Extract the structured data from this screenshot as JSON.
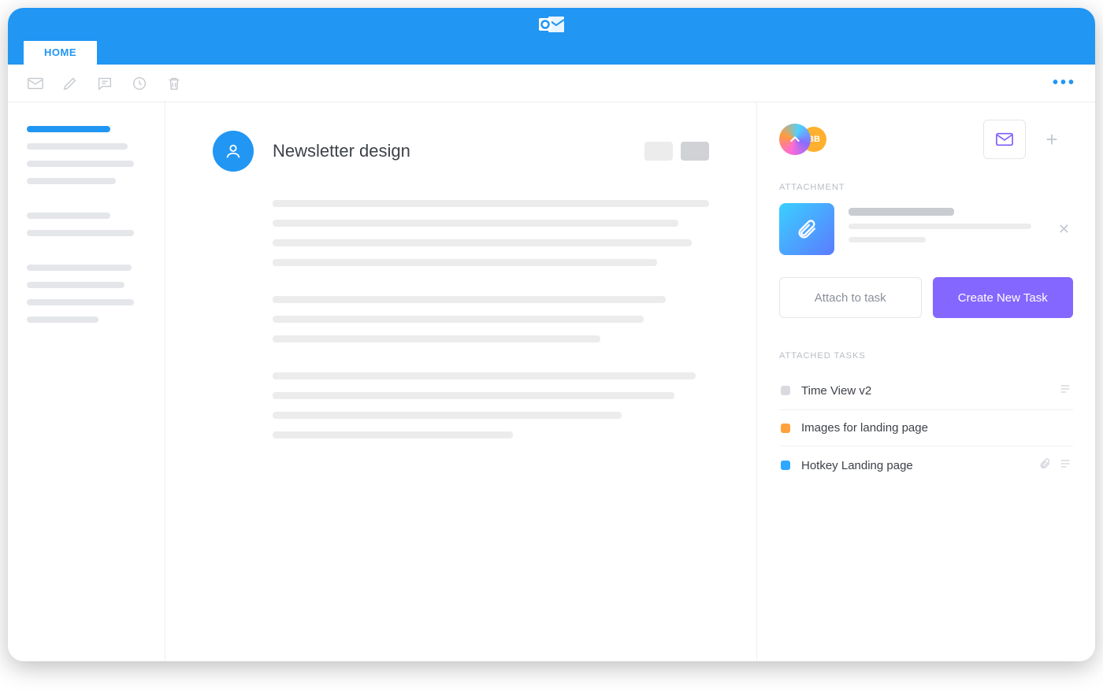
{
  "app": {
    "name": "Outlook"
  },
  "tabs": {
    "home": "HOME"
  },
  "mail": {
    "subject": "Newsletter design"
  },
  "panel": {
    "bb_label": "BB",
    "attachment_label": "ATTACHMENT",
    "attach_btn": "Attach to task",
    "create_btn": "Create New Task",
    "attached_label": "ATTACHED TASKS",
    "tasks": [
      {
        "title": "Time View v2",
        "status": "grey",
        "clip": false,
        "note": true
      },
      {
        "title": "Images for landing page",
        "status": "orange",
        "clip": false,
        "note": false
      },
      {
        "title": "Hotkey Landing page",
        "status": "blue",
        "clip": true,
        "note": true
      }
    ]
  },
  "colors": {
    "brand": "#2196f3",
    "accent": "#8467ff"
  }
}
